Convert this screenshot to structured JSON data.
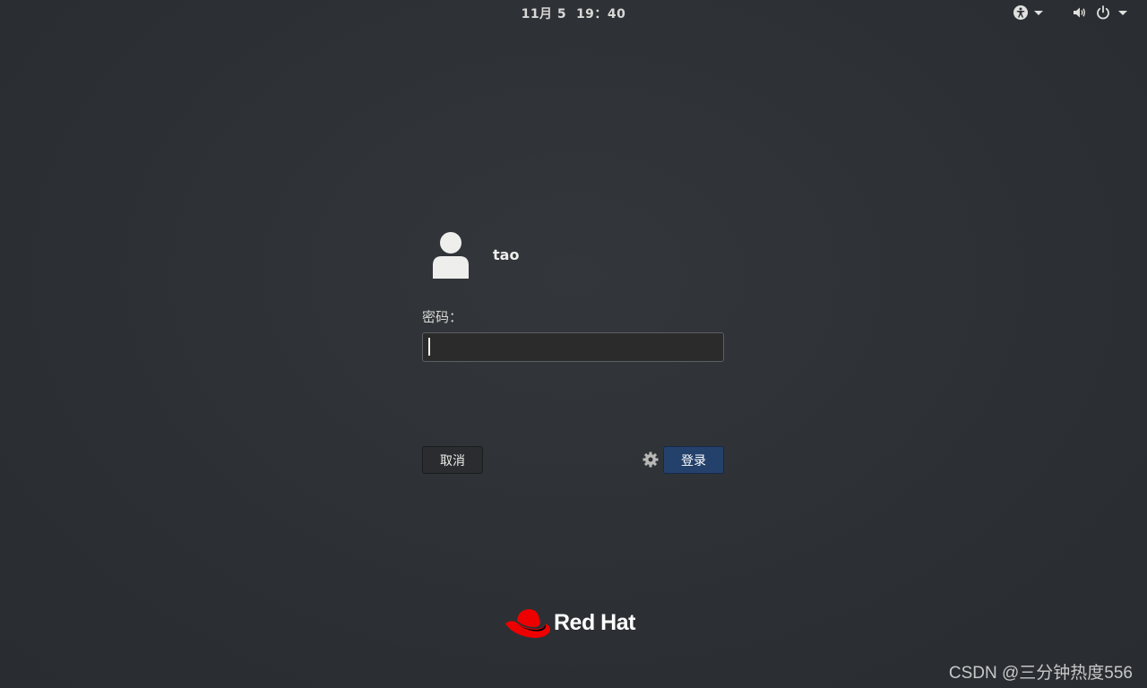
{
  "topbar": {
    "date": "11月 5",
    "time": "19：40",
    "icons": {
      "accessibility": "accessibility-icon",
      "volume": "volume-icon",
      "power": "power-icon"
    }
  },
  "login": {
    "username": "tao",
    "password_label": "密码：",
    "password_value": "",
    "cancel_label": "取消",
    "login_label": "登录",
    "accent_color": "#24416b"
  },
  "branding": {
    "logo_text": "Red Hat",
    "logo_color": "#ee0000"
  },
  "watermark": "CSDN @三分钟热度556"
}
